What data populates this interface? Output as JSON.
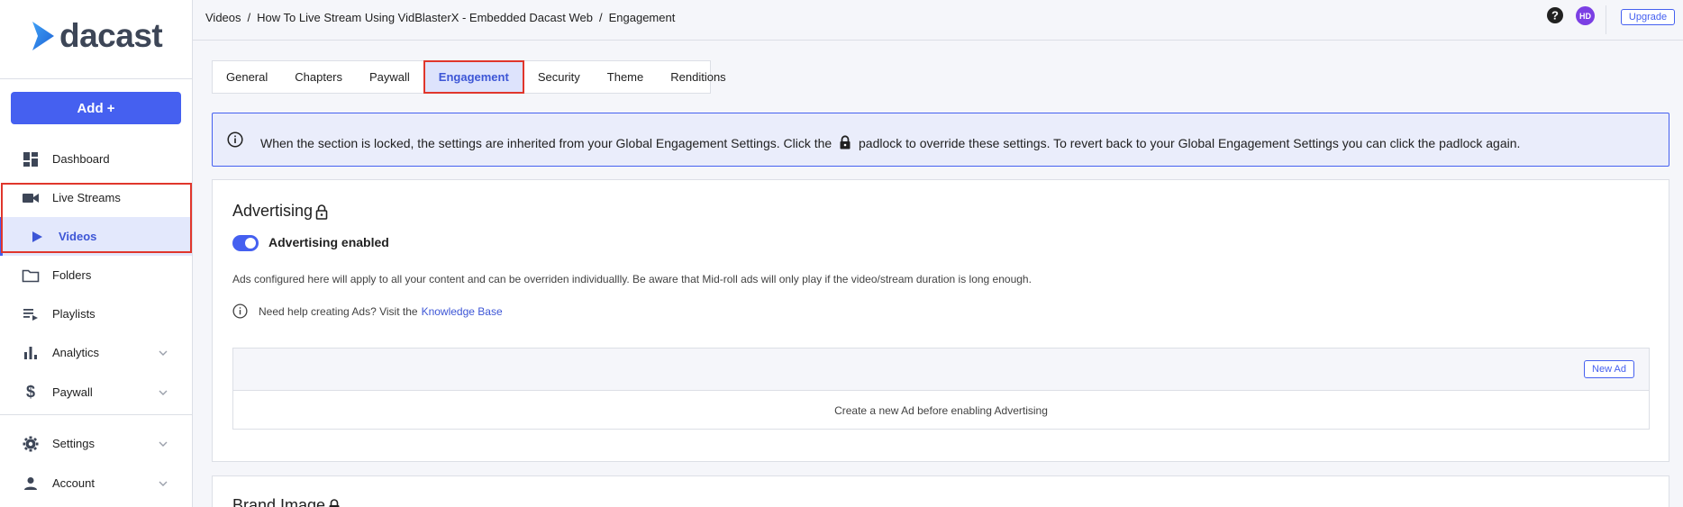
{
  "brand": {
    "name": "dacast"
  },
  "sidebar": {
    "add_label": "Add +",
    "items": [
      {
        "label": "Dashboard",
        "icon": "dashboard-icon"
      },
      {
        "label": "Live Streams",
        "icon": "video-camera-icon"
      },
      {
        "label": "Videos",
        "icon": "play-icon",
        "active": true
      },
      {
        "label": "Folders",
        "icon": "folder-icon"
      },
      {
        "label": "Playlists",
        "icon": "playlist-icon"
      },
      {
        "label": "Analytics",
        "icon": "bar-chart-icon",
        "expandable": true
      },
      {
        "label": "Paywall",
        "icon": "dollar-icon",
        "expandable": true
      },
      {
        "label": "Settings",
        "icon": "gear-icon",
        "expandable": true
      },
      {
        "label": "Account",
        "icon": "person-icon",
        "expandable": true
      }
    ]
  },
  "topbar": {
    "breadcrumb": [
      "Videos",
      "How To Live Stream Using VidBlasterX - Embedded Dacast Web",
      "Engagement"
    ],
    "breadcrumb_sep": "/",
    "avatar_initials": "HD",
    "upgrade_label": "Upgrade"
  },
  "tabs": [
    "General",
    "Chapters",
    "Paywall",
    "Engagement",
    "Security",
    "Theme",
    "Renditions"
  ],
  "active_tab": "Engagement",
  "banner": {
    "text_before": "When the section is locked, the settings are inherited from your Global Engagement Settings. Click the",
    "text_after": "padlock to override these settings. To revert back to your Global Engagement Settings you can click the padlock again."
  },
  "advertising": {
    "title": "Advertising",
    "toggle_label": "Advertising enabled",
    "toggle_on": true,
    "description": "Ads configured here will apply to all your content and can be overriden individuallly. Be aware that Mid-roll ads will only play if the video/stream duration is long enough.",
    "help_text": "Need help creating Ads? Visit the",
    "help_link": "Knowledge Base",
    "new_ad_label": "New Ad",
    "empty_text": "Create a new Ad before enabling Advertising"
  },
  "brand_image": {
    "title": "Brand Image"
  },
  "colors": {
    "accent": "#4560f0",
    "highlight": "#e0362c",
    "avatar": "#7b3fe4"
  }
}
